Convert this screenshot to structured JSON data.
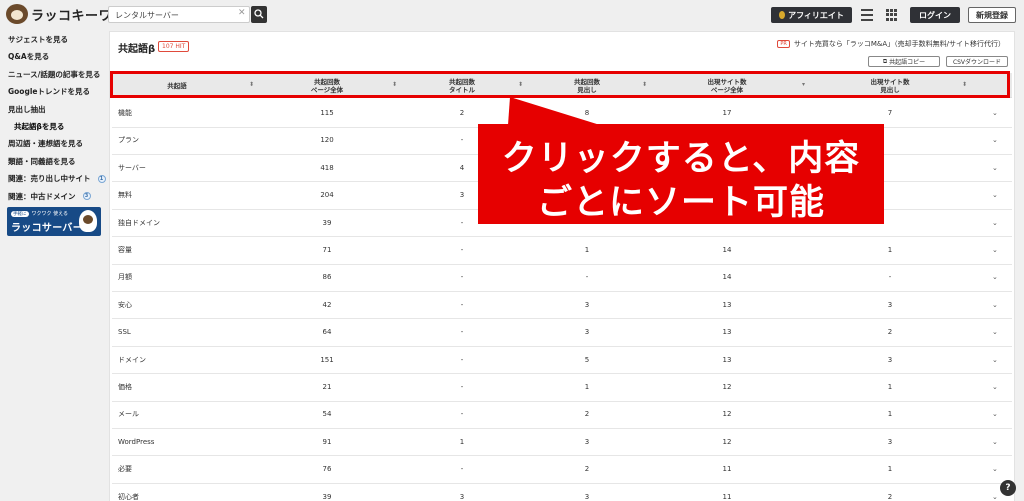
{
  "header": {
    "logo_text": "ラッコキーワード",
    "search_value": "レンタルサーバー",
    "affiliate_label": "アフィリエイト",
    "login_label": "ログイン",
    "register_label": "新規登録"
  },
  "sidebar": {
    "items": [
      {
        "label": "サジェストを見る",
        "sub": false
      },
      {
        "label": "Q&Aを見る",
        "sub": false
      },
      {
        "label": "ニュース/話題の記事を見る",
        "sub": false
      },
      {
        "label": "Googleトレンドを見る",
        "sub": false
      },
      {
        "label": "見出し抽出",
        "sub": false
      },
      {
        "label": "共起語βを見る",
        "sub": true
      },
      {
        "label": "周辺語・連想語を見る",
        "sub": false
      },
      {
        "label": "類語・同義語を見る",
        "sub": false
      },
      {
        "label": "関連：売り出し中サイト",
        "sub": false,
        "badge": "1"
      },
      {
        "label": "関連：中古ドメイン",
        "sub": false,
        "badge": "3"
      }
    ],
    "banner": {
      "small": "ワクワク 使える",
      "pill": "手軽に",
      "big": "ラッコサーバー"
    }
  },
  "panel": {
    "title": "共起語β",
    "hit_badge": "107 HIT",
    "pr_tag": "PR",
    "pr_text": "サイト売買なら「ラッコM&A」（売却手数料無料/サイト移行代行）",
    "copy_button": "共起語コピー",
    "csv_button": "CSVダウンロード"
  },
  "table": {
    "columns": [
      {
        "line1": "共起語",
        "line2": ""
      },
      {
        "line1": "共起回数",
        "line2": "ページ全体"
      },
      {
        "line1": "共起回数",
        "line2": "タイトル"
      },
      {
        "line1": "共起回数",
        "line2": "見出し"
      },
      {
        "line1": "出現サイト数",
        "line2": "ページ全体"
      },
      {
        "line1": "出現サイト数",
        "line2": "見出し"
      }
    ],
    "rows": [
      [
        "機能",
        "115",
        "2",
        "8",
        "17",
        "7"
      ],
      [
        "プラン",
        "120",
        "-",
        "",
        "",
        ""
      ],
      [
        "サーバー",
        "418",
        "4",
        "",
        "",
        ""
      ],
      [
        "無料",
        "204",
        "3",
        "",
        "",
        ""
      ],
      [
        "独自ドメイン",
        "39",
        "-",
        "",
        "",
        ""
      ],
      [
        "容量",
        "71",
        "-",
        "1",
        "14",
        "1"
      ],
      [
        "月額",
        "86",
        "-",
        "-",
        "14",
        "-"
      ],
      [
        "安心",
        "42",
        "-",
        "3",
        "13",
        "3"
      ],
      [
        "SSL",
        "64",
        "-",
        "3",
        "13",
        "2"
      ],
      [
        "ドメイン",
        "151",
        "-",
        "5",
        "13",
        "3"
      ],
      [
        "価格",
        "21",
        "-",
        "1",
        "12",
        "1"
      ],
      [
        "メール",
        "54",
        "-",
        "2",
        "12",
        "1"
      ],
      [
        "WordPress",
        "91",
        "1",
        "3",
        "12",
        "3"
      ],
      [
        "必要",
        "76",
        "-",
        "2",
        "11",
        "1"
      ],
      [
        "初心者",
        "39",
        "3",
        "3",
        "11",
        "2"
      ]
    ]
  },
  "callout": {
    "line1": "クリックすると、内容",
    "line2": "ごとにソート可能"
  },
  "help_label": "?",
  "colors": {
    "accent": "#e60000",
    "dark": "#2f3136",
    "banner": "#174a86"
  }
}
